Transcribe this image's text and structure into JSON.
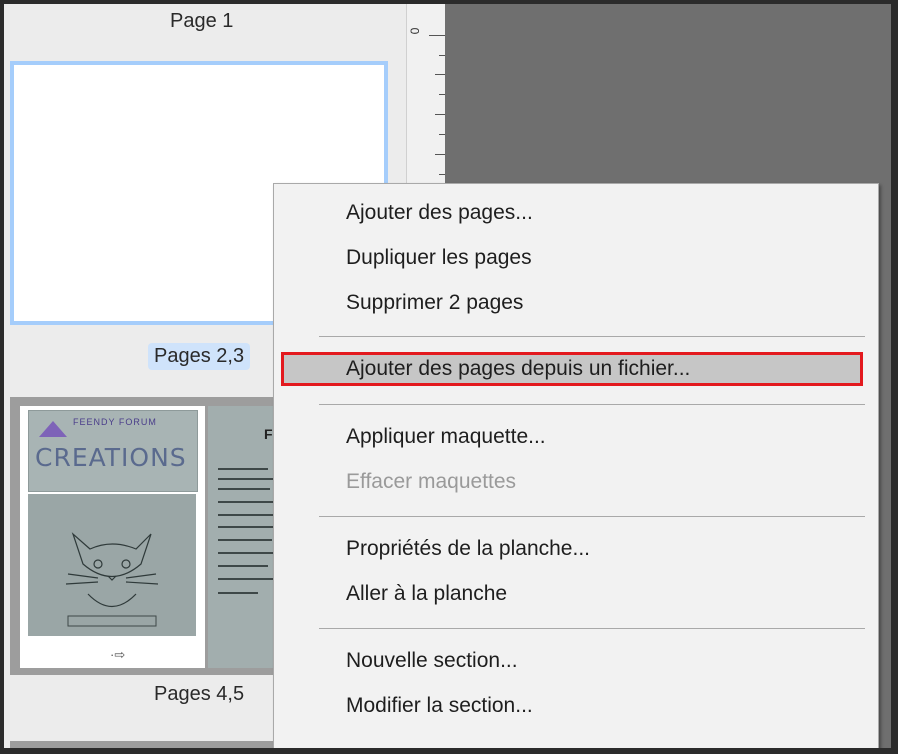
{
  "panel": {
    "page1_label": "Page 1",
    "pages23_label": "Pages 2,3",
    "pages45_label": "Pages 4,5",
    "thumbnail_cover": {
      "logo_text": "FEENDY FORUM",
      "title": "CREATIONS",
      "right_page_initial": "F"
    }
  },
  "ruler": {
    "zero_label": "0"
  },
  "context_menu": {
    "items": [
      {
        "label": "Ajouter des pages...",
        "enabled": true
      },
      {
        "label": "Dupliquer les pages",
        "enabled": true
      },
      {
        "label": "Supprimer 2 pages",
        "enabled": true
      },
      {
        "label": "Ajouter des pages depuis un fichier...",
        "enabled": true,
        "highlighted": true
      },
      {
        "label": "Appliquer maquette...",
        "enabled": true
      },
      {
        "label": "Effacer maquettes",
        "enabled": false
      },
      {
        "label": "Propriétés de la planche...",
        "enabled": true
      },
      {
        "label": "Aller à la planche",
        "enabled": true
      },
      {
        "label": "Nouvelle section...",
        "enabled": true
      },
      {
        "label": "Modifier la section...",
        "enabled": true
      }
    ]
  },
  "colors": {
    "selection_border": "#a5cdfb",
    "selected_label_bg": "#cfe3fb",
    "highlight_outline": "#e3191e",
    "menu_bg": "#f2f2f2"
  }
}
